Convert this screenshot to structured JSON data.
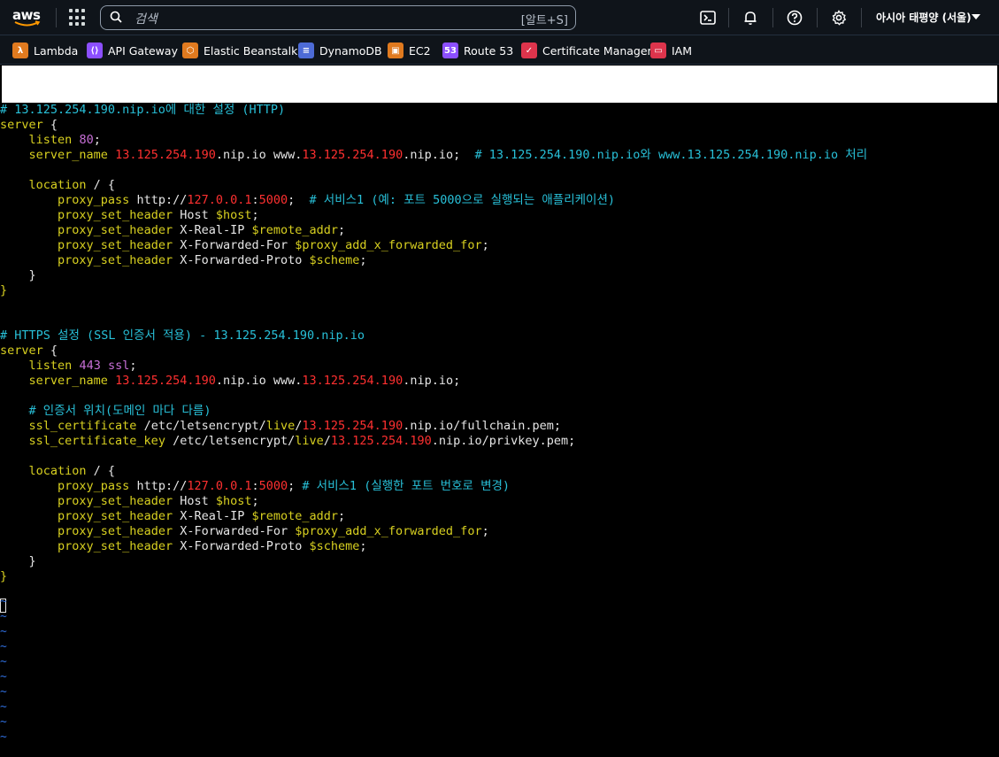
{
  "header": {
    "logo_text": "aws",
    "search_placeholder": "검색",
    "search_shortcut": "[알트+S]",
    "region": "아시아 태평양 (서울)",
    "icons": [
      "cloudshell-icon",
      "bell-icon",
      "help-icon",
      "gear-icon"
    ]
  },
  "favorites": [
    {
      "label": "Lambda",
      "color": "#e07a1f",
      "glyph": "λ"
    },
    {
      "label": "API Gateway",
      "color": "#8c4fff",
      "glyph": "⟨⟩"
    },
    {
      "label": "Elastic Beanstalk",
      "color": "#e07a1f",
      "glyph": "⬡"
    },
    {
      "label": "DynamoDB",
      "color": "#4d6bd6",
      "glyph": "≡"
    },
    {
      "label": "EC2",
      "color": "#e07a1f",
      "glyph": "▣"
    },
    {
      "label": "Route 53",
      "color": "#8c4fff",
      "glyph": "53"
    },
    {
      "label": "Certificate Manager",
      "color": "#dd344c",
      "glyph": "✓"
    },
    {
      "label": "IAM",
      "color": "#dd344c",
      "glyph": "▭"
    }
  ],
  "editor": {
    "lines": [
      [
        [
          "c",
          "# 13.125.254.190.nip.io에 대한 설정 (HTTP)"
        ]
      ],
      [
        [
          "g",
          "server"
        ],
        [
          "w",
          " {"
        ]
      ],
      [
        [
          "w",
          "    "
        ],
        [
          "g",
          "listen"
        ],
        [
          "w",
          " "
        ],
        [
          "p",
          "80"
        ],
        [
          "w",
          ";"
        ]
      ],
      [
        [
          "w",
          "    "
        ],
        [
          "g",
          "server_name"
        ],
        [
          "w",
          " "
        ],
        [
          "r",
          "13.125.254.190"
        ],
        [
          "w",
          ".nip.io www."
        ],
        [
          "r",
          "13.125.254.190"
        ],
        [
          "w",
          ".nip.io;  "
        ],
        [
          "c",
          "# 13.125.254.190.nip.io와 www.13.125.254.190.nip.io 처리"
        ]
      ],
      [
        [
          "w",
          ""
        ]
      ],
      [
        [
          "w",
          "    "
        ],
        [
          "g",
          "location"
        ],
        [
          "w",
          " / {"
        ]
      ],
      [
        [
          "w",
          "        "
        ],
        [
          "g",
          "proxy_pass"
        ],
        [
          "w",
          " http://"
        ],
        [
          "r",
          "127.0.0.1"
        ],
        [
          "w",
          ":"
        ],
        [
          "r",
          "5000"
        ],
        [
          "w",
          ";  "
        ],
        [
          "c",
          "# 서비스1 (예: 포트 5000으로 실행되는 애플리케이션)"
        ]
      ],
      [
        [
          "w",
          "        "
        ],
        [
          "g",
          "proxy_set_header"
        ],
        [
          "w",
          " Host "
        ],
        [
          "g",
          "$host"
        ],
        [
          "w",
          ";"
        ]
      ],
      [
        [
          "w",
          "        "
        ],
        [
          "g",
          "proxy_set_header"
        ],
        [
          "w",
          " X-Real-IP "
        ],
        [
          "g",
          "$remote_addr"
        ],
        [
          "w",
          ";"
        ]
      ],
      [
        [
          "w",
          "        "
        ],
        [
          "g",
          "proxy_set_header"
        ],
        [
          "w",
          " X-Forwarded-For "
        ],
        [
          "g",
          "$proxy_add_x_forwarded_for"
        ],
        [
          "w",
          ";"
        ]
      ],
      [
        [
          "w",
          "        "
        ],
        [
          "g",
          "proxy_set_header"
        ],
        [
          "w",
          " X-Forwarded-Proto "
        ],
        [
          "g",
          "$scheme"
        ],
        [
          "w",
          ";"
        ]
      ],
      [
        [
          "w",
          "    }"
        ]
      ],
      [
        [
          "g",
          "}"
        ]
      ],
      [
        [
          "w",
          ""
        ]
      ],
      [
        [
          "w",
          ""
        ]
      ],
      [
        [
          "c",
          "# HTTPS 설정 (SSL 인증서 적용) - 13.125.254.190.nip.io"
        ]
      ],
      [
        [
          "g",
          "server"
        ],
        [
          "w",
          " {"
        ]
      ],
      [
        [
          "w",
          "    "
        ],
        [
          "g",
          "listen"
        ],
        [
          "w",
          " "
        ],
        [
          "p",
          "443 ssl"
        ],
        [
          "w",
          ";"
        ]
      ],
      [
        [
          "w",
          "    "
        ],
        [
          "g",
          "server_name"
        ],
        [
          "w",
          " "
        ],
        [
          "r",
          "13.125.254.190"
        ],
        [
          "w",
          ".nip.io www."
        ],
        [
          "r",
          "13.125.254.190"
        ],
        [
          "w",
          ".nip.io;"
        ]
      ],
      [
        [
          "w",
          ""
        ]
      ],
      [
        [
          "w",
          "    "
        ],
        [
          "c",
          "# 인증서 위치(도메인 마다 다름)"
        ]
      ],
      [
        [
          "w",
          "    "
        ],
        [
          "g",
          "ssl_certificate"
        ],
        [
          "w",
          " /etc/letsencrypt/"
        ],
        [
          "g",
          "live"
        ],
        [
          "w",
          "/"
        ],
        [
          "r",
          "13.125.254.190"
        ],
        [
          "w",
          ".nip.io/fullchain.pem;"
        ]
      ],
      [
        [
          "w",
          "    "
        ],
        [
          "g",
          "ssl_certificate_key"
        ],
        [
          "w",
          " /etc/letsencrypt/"
        ],
        [
          "g",
          "live"
        ],
        [
          "w",
          "/"
        ],
        [
          "r",
          "13.125.254.190"
        ],
        [
          "w",
          ".nip.io/privkey.pem;"
        ]
      ],
      [
        [
          "w",
          ""
        ]
      ],
      [
        [
          "w",
          "    "
        ],
        [
          "g",
          "location"
        ],
        [
          "w",
          " / {"
        ]
      ],
      [
        [
          "w",
          "        "
        ],
        [
          "g",
          "proxy_pass"
        ],
        [
          "w",
          " http://"
        ],
        [
          "r",
          "127.0.0.1"
        ],
        [
          "w",
          ":"
        ],
        [
          "r",
          "5000"
        ],
        [
          "w",
          "; "
        ],
        [
          "c",
          "# 서비스1 (실행한 포트 번호로 변경)"
        ]
      ],
      [
        [
          "w",
          "        "
        ],
        [
          "g",
          "proxy_set_header"
        ],
        [
          "w",
          " Host "
        ],
        [
          "g",
          "$host"
        ],
        [
          "w",
          ";"
        ]
      ],
      [
        [
          "w",
          "        "
        ],
        [
          "g",
          "proxy_set_header"
        ],
        [
          "w",
          " X-Real-IP "
        ],
        [
          "g",
          "$remote_addr"
        ],
        [
          "w",
          ";"
        ]
      ],
      [
        [
          "w",
          "        "
        ],
        [
          "g",
          "proxy_set_header"
        ],
        [
          "w",
          " X-Forwarded-For "
        ],
        [
          "g",
          "$proxy_add_x_forwarded_for"
        ],
        [
          "w",
          ";"
        ]
      ],
      [
        [
          "w",
          "        "
        ],
        [
          "g",
          "proxy_set_header"
        ],
        [
          "w",
          " X-Forwarded-Proto "
        ],
        [
          "g",
          "$scheme"
        ],
        [
          "w",
          ";"
        ]
      ],
      [
        [
          "w",
          "    }"
        ]
      ],
      [
        [
          "g",
          "}"
        ]
      ]
    ],
    "tilde_char": "~",
    "tilde_count": 10
  }
}
